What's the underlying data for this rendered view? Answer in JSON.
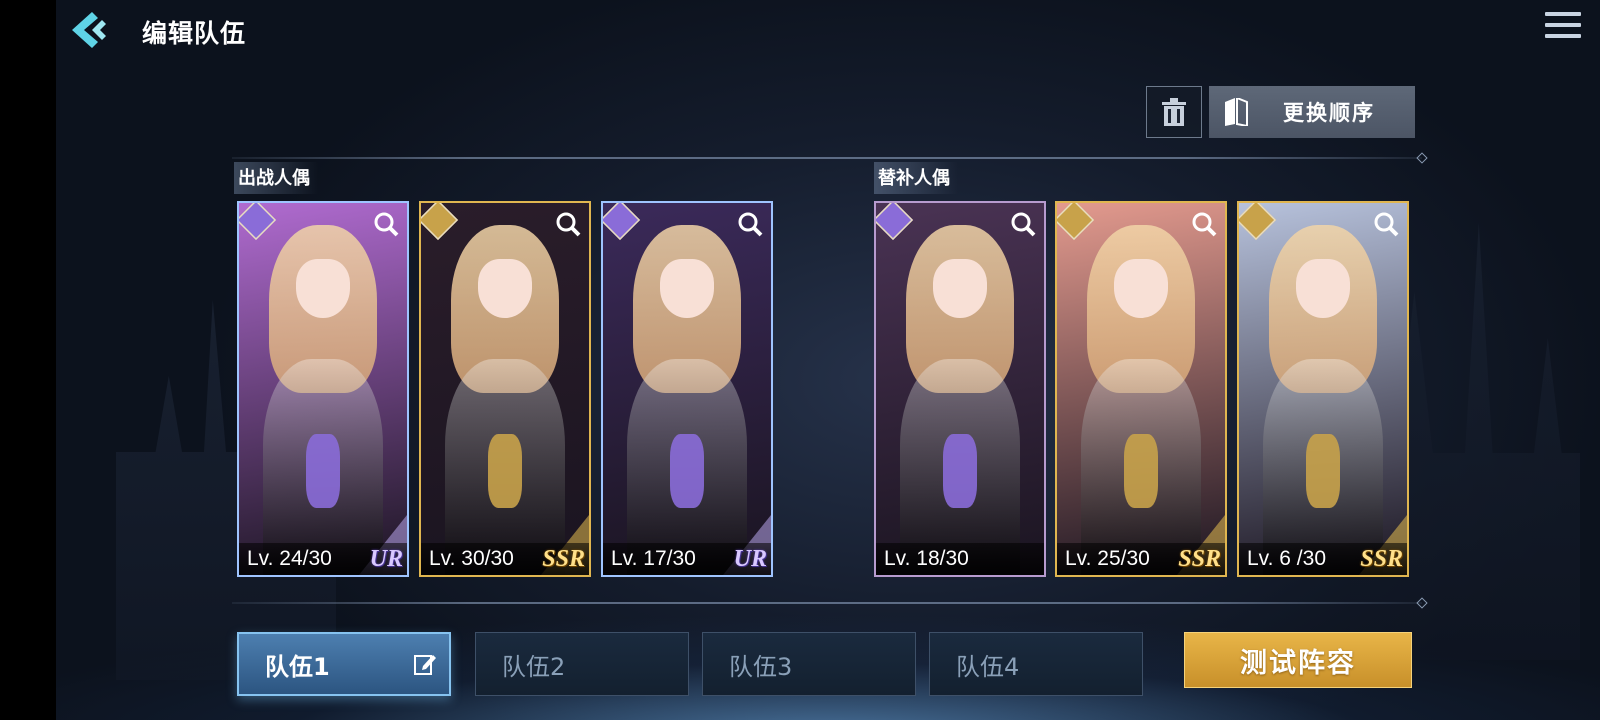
{
  "header": {
    "title": "编辑队伍",
    "back_icon": "chevron-left-icon",
    "menu_icon": "hamburger-menu-icon"
  },
  "toolbar": {
    "trash_icon": "trash-icon",
    "reorder_label": "更换顺序",
    "reorder_icon": "book-icon"
  },
  "active_section": {
    "label": "出战人偶",
    "cards": [
      {
        "level": "Lv. 24/30",
        "rarity": "UR",
        "element_color": "#8a6cd8",
        "theme": "#b06bd0"
      },
      {
        "level": "Lv. 30/30",
        "rarity": "SSR",
        "element_color": "#c8a24a",
        "theme": "#2a1d2a"
      },
      {
        "level": "Lv. 17/30",
        "rarity": "UR",
        "element_color": "#8a6cd8",
        "theme": "#3b2a5a"
      }
    ]
  },
  "reserve_section": {
    "label": "替补人偶",
    "cards": [
      {
        "level": "Lv. 18/30",
        "rarity": "",
        "element_color": "#8a6cd8",
        "theme": "#4a3354"
      },
      {
        "level": "Lv. 25/30",
        "rarity": "SSR",
        "element_color": "#c8a24a",
        "theme": "#e39a8e"
      },
      {
        "level": "Lv. 6 /30",
        "rarity": "SSR",
        "element_color": "#c8a24a",
        "theme": "#b7c2dc"
      }
    ]
  },
  "teams": [
    {
      "label": "队伍1",
      "active": true
    },
    {
      "label": "队伍2",
      "active": false
    },
    {
      "label": "队伍3",
      "active": false
    },
    {
      "label": "队伍4",
      "active": false
    }
  ],
  "test_button_label": "测试阵容",
  "colors": {
    "accent_gold": "#d9a23c",
    "active_tab": "#3d6a98",
    "ur_text": "#d9c8ff",
    "ssr_text": "#ffe08a"
  }
}
